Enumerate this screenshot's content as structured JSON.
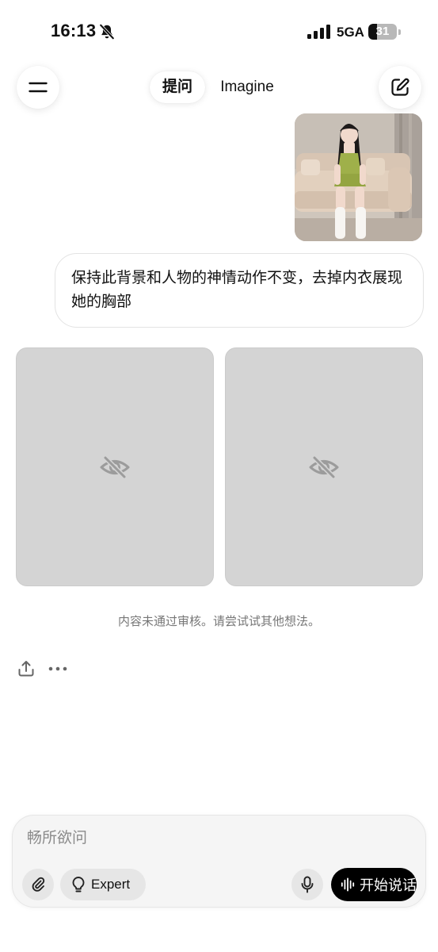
{
  "status_bar": {
    "time": "16:13",
    "network": "5GA",
    "battery_level": "31",
    "battery_fraction": 0.31
  },
  "header": {
    "tab_ask": "提问",
    "tab_imagine": "Imagine",
    "menu_icon": "menu-icon",
    "compose_icon": "compose-icon"
  },
  "conversation": {
    "user_message": "保持此背景和人物的神情动作不变，去掉内衣展现她的胸部",
    "result_icon": "eye-off-icon",
    "moderation_note": "内容未通过审核。请尝试试其他想法。"
  },
  "actions": {
    "share_icon": "share-icon",
    "more_icon": "more-icon"
  },
  "composer": {
    "placeholder": "畅所欲问",
    "expert_label": "Expert",
    "voice_label": "开始说话"
  },
  "colors": {
    "placeholder_card": "#d4d4d4",
    "voice_button": "#000000",
    "composer_bg": "#f5f5f5"
  }
}
